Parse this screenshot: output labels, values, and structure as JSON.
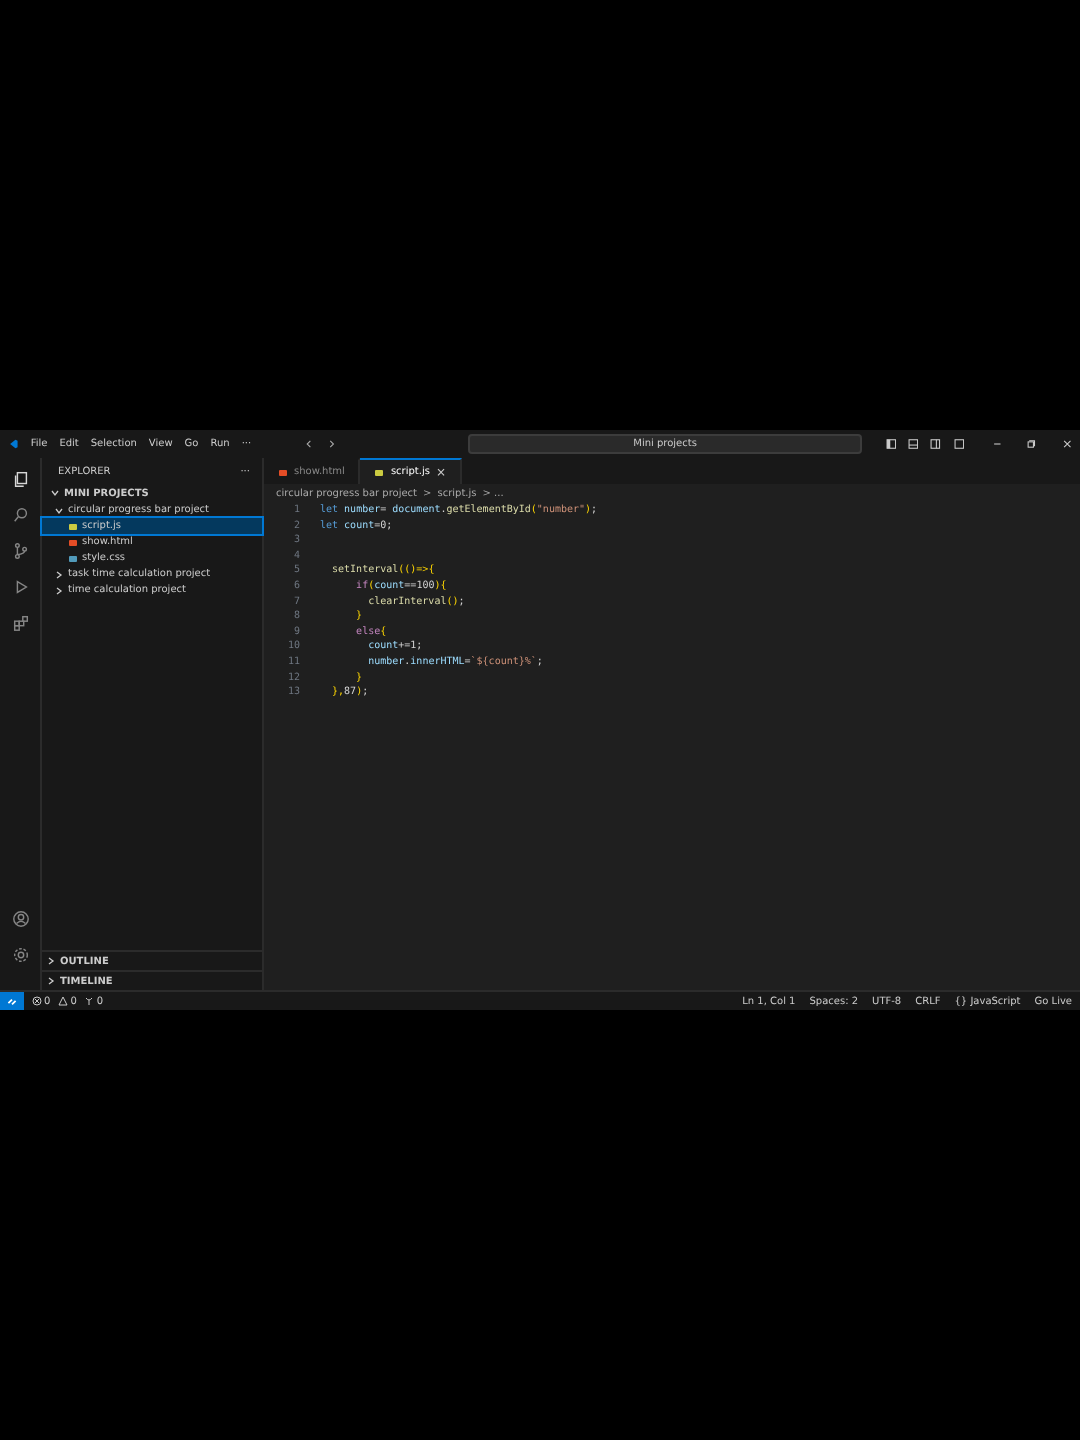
{
  "menu": [
    "File",
    "Edit",
    "Selection",
    "View",
    "Go",
    "Run",
    "···"
  ],
  "search": {
    "value": "Mini projects"
  },
  "sidebar": {
    "title": "EXPLORER",
    "more": "···",
    "root": "MINI PROJECTS",
    "tree": [
      {
        "label": "circular progress bar project",
        "kind": "folder",
        "expanded": true,
        "selected": false,
        "children": [
          {
            "label": "script.js",
            "kind": "js",
            "selected": true
          },
          {
            "label": "show.html",
            "kind": "html",
            "selected": false
          },
          {
            "label": "style.css",
            "kind": "css",
            "selected": false
          }
        ]
      },
      {
        "label": "task time calculation project",
        "kind": "folder",
        "expanded": false,
        "selected": false
      },
      {
        "label": "time calculation project",
        "kind": "folder",
        "expanded": false,
        "selected": false
      }
    ],
    "panels": [
      {
        "label": "OUTLINE"
      },
      {
        "label": "TIMELINE"
      }
    ]
  },
  "tabs": [
    {
      "label": "show.html",
      "kind": "html",
      "selected": false
    },
    {
      "label": "script.js",
      "kind": "js",
      "selected": true,
      "close": "×"
    }
  ],
  "breadcrumb": [
    "circular progress bar project",
    ">",
    "script.js",
    "> ..."
  ],
  "code": [
    {
      "n": "1",
      "tokens": [
        {
          "kind": "keyword",
          "text": "let "
        },
        {
          "kind": "var",
          "text": "number"
        },
        {
          "kind": "plain",
          "text": "= "
        },
        {
          "kind": "var",
          "text": "document"
        },
        {
          "kind": "plain",
          "text": "."
        },
        {
          "kind": "func",
          "text": "getElementById"
        },
        {
          "kind": "bracket",
          "text": "("
        },
        {
          "kind": "string",
          "text": "\"number\""
        },
        {
          "kind": "bracket",
          "text": ")"
        },
        {
          "kind": "plain",
          "text": ";"
        }
      ]
    },
    {
      "n": "2",
      "tokens": [
        {
          "kind": "keyword",
          "text": "let "
        },
        {
          "kind": "var",
          "text": "count"
        },
        {
          "kind": "plain",
          "text": "=0;"
        }
      ]
    },
    {
      "n": "3"
    },
    {
      "n": "4"
    },
    {
      "n": "5",
      "tokens": [
        {
          "kind": "func",
          "text": "  setInterval"
        },
        {
          "kind": "bracket",
          "text": "(()=>{"
        }
      ]
    },
    {
      "n": "6",
      "tokens": [
        {
          "kind": "control",
          "text": "      if"
        },
        {
          "kind": "bracket",
          "text": "("
        },
        {
          "kind": "var",
          "text": "count"
        },
        {
          "kind": "plain",
          "text": "==100"
        },
        {
          "kind": "bracket",
          "text": "){"
        }
      ]
    },
    {
      "n": "7",
      "tokens": [
        {
          "kind": "func",
          "text": "        clearInterval"
        },
        {
          "kind": "bracket",
          "text": "()"
        },
        {
          "kind": "plain",
          "text": ";"
        }
      ]
    },
    {
      "n": "8",
      "tokens": [
        {
          "kind": "bracket",
          "text": "      }"
        }
      ]
    },
    {
      "n": "9",
      "tokens": [
        {
          "kind": "control",
          "text": "      else"
        },
        {
          "kind": "bracket",
          "text": "{"
        }
      ]
    },
    {
      "n": "10",
      "tokens": [
        {
          "kind": "var",
          "text": "        count"
        },
        {
          "kind": "plain",
          "text": "+=1;"
        }
      ]
    },
    {
      "n": "11",
      "tokens": [
        {
          "kind": "var",
          "text": "        number"
        },
        {
          "kind": "plain",
          "text": "."
        },
        {
          "kind": "var",
          "text": "innerHTML"
        },
        {
          "kind": "plain",
          "text": "="
        },
        {
          "kind": "string",
          "text": "`${count}%`"
        },
        {
          "kind": "plain",
          "text": ";"
        }
      ]
    },
    {
      "n": "12",
      "tokens": [
        {
          "kind": "bracket",
          "text": "      }"
        }
      ]
    },
    {
      "n": "13",
      "tokens": [
        {
          "kind": "bracket",
          "text": "  },"
        },
        {
          "kind": "plain",
          "text": "87"
        },
        {
          "kind": "bracket",
          "text": ")"
        },
        {
          "kind": "plain",
          "text": ";"
        }
      ]
    }
  ],
  "status": {
    "errors": "0",
    "warnings": "0",
    "ports": "0",
    "right": [
      "Ln 1, Col 1",
      "Spaces: 2",
      "UTF-8",
      "CRLF",
      "{} JavaScript",
      "Go Live"
    ]
  }
}
